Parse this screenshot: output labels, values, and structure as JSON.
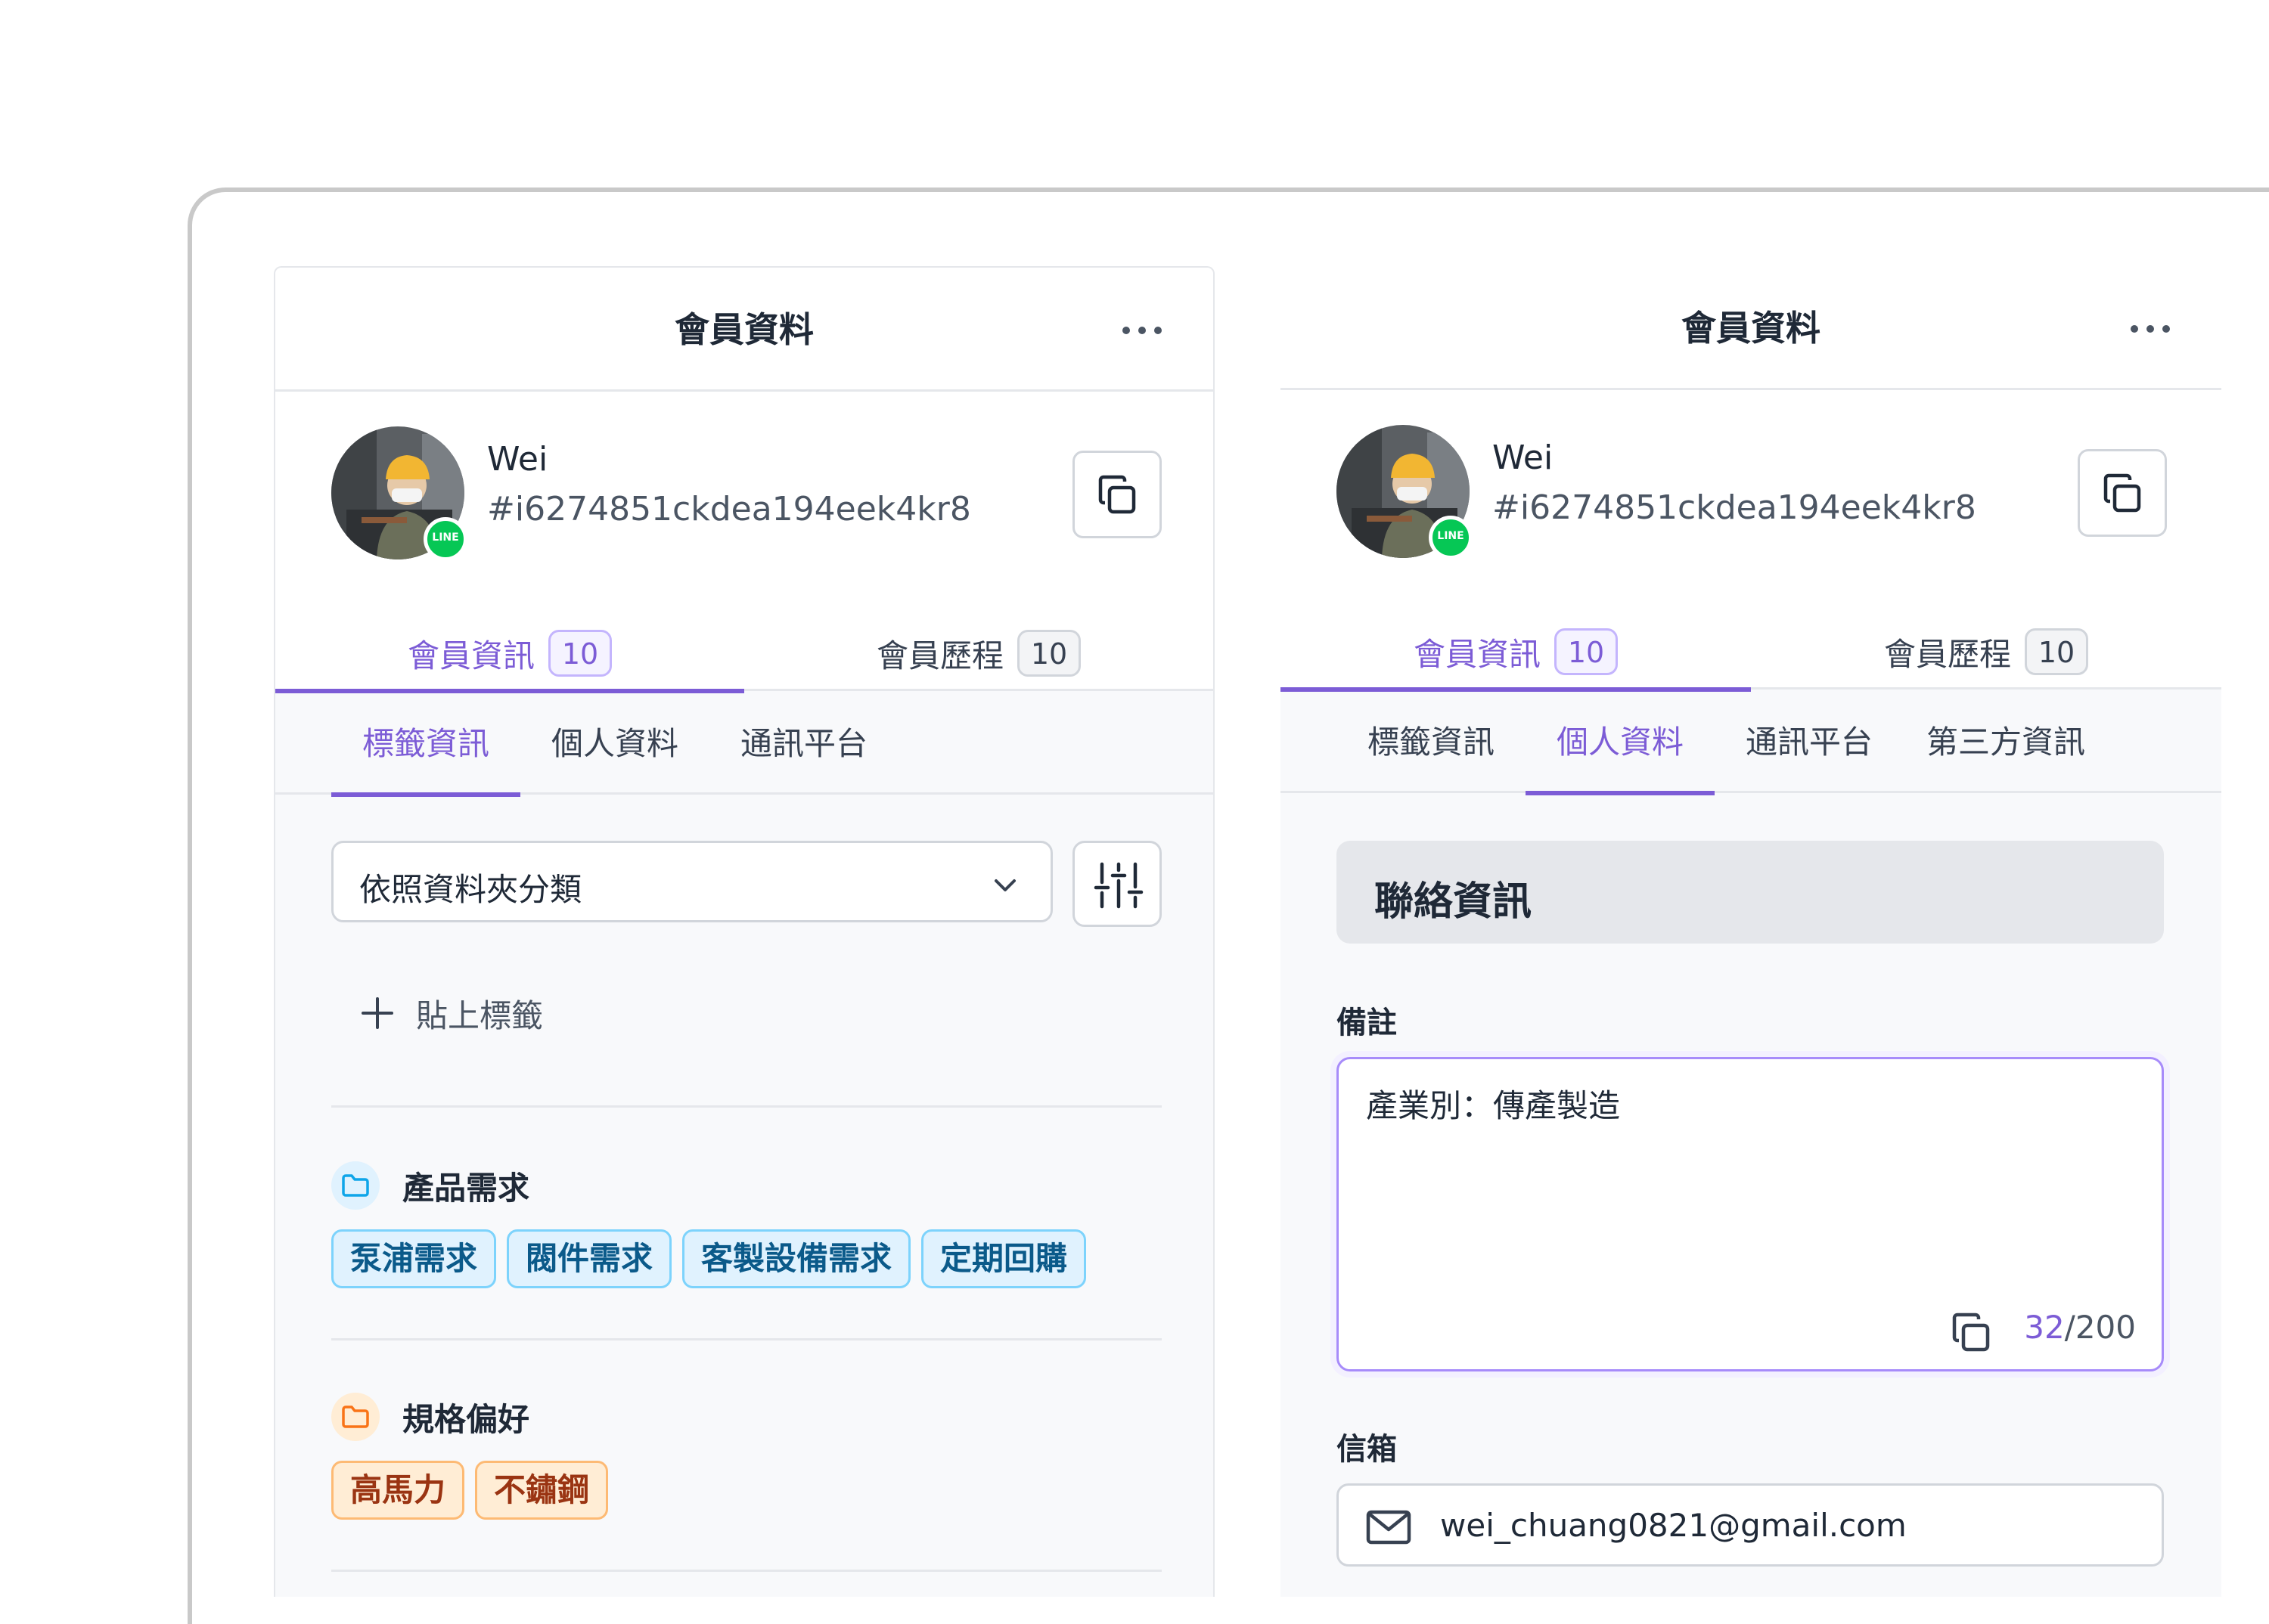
{
  "panels": {
    "left": {
      "title": "會員資料",
      "user": {
        "name": "Wei",
        "id": "#i6274851ckdea194eek4kr8",
        "platform_badge": "LINE"
      },
      "main_tabs": [
        {
          "label": "會員資訊",
          "count": "10",
          "active": true
        },
        {
          "label": "會員歷程",
          "count": "10",
          "active": false
        }
      ],
      "sub_tabs": [
        {
          "label": "標籤資訊",
          "active": true
        },
        {
          "label": "個人資料",
          "active": false
        },
        {
          "label": "通訊平台",
          "active": false
        }
      ],
      "group_select": {
        "value": "依照資料夾分類"
      },
      "add_tag_label": "貼上標籤",
      "folders": [
        {
          "name": "產品需求",
          "color": "blue",
          "tags": [
            "泵浦需求",
            "閥件需求",
            "客製設備需求",
            "定期回購"
          ]
        },
        {
          "name": "規格偏好",
          "color": "orange",
          "tags": [
            "高馬力",
            "不鏽鋼"
          ]
        }
      ]
    },
    "right": {
      "title": "會員資料",
      "user": {
        "name": "Wei",
        "id": "#i6274851ckdea194eek4kr8",
        "platform_badge": "LINE"
      },
      "main_tabs": [
        {
          "label": "會員資訊",
          "count": "10",
          "active": true
        },
        {
          "label": "會員歷程",
          "count": "10",
          "active": false
        }
      ],
      "sub_tabs": [
        {
          "label": "標籤資訊",
          "active": false
        },
        {
          "label": "個人資料",
          "active": true
        },
        {
          "label": "通訊平台",
          "active": false
        },
        {
          "label": "第三方資訊",
          "active": false
        }
      ],
      "section_title": "聯絡資訊",
      "note": {
        "label": "備註",
        "value": "產業別：傳產製造",
        "count_current": "32",
        "count_max": "/200"
      },
      "email": {
        "label": "信箱",
        "value": "wei_chuang0821@gmail.com"
      }
    }
  },
  "colors": {
    "accent": "#7c5cd6",
    "line_green": "#06c755",
    "tag_blue_bg": "#e0f2fe",
    "tag_orange_bg": "#ffedd5"
  },
  "icons": [
    "more-icon",
    "copy-icon",
    "chevron-down-icon",
    "sliders-icon",
    "plus-icon",
    "folder-icon",
    "mail-icon",
    "line-icon"
  ]
}
